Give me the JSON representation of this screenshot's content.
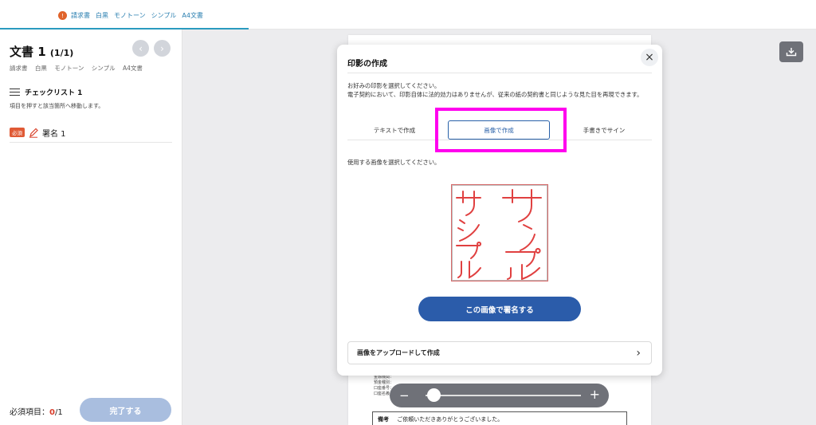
{
  "topbar": {
    "tab_badge": "!",
    "tags": [
      "請求書",
      "白黒",
      "モノトーン",
      "シンプル",
      "A4文書"
    ]
  },
  "sidebar": {
    "doc_title": "文書 1",
    "doc_count": "(1/1)",
    "prev_icon": "chevron-left-icon",
    "next_icon": "chevron-right-icon",
    "tags": [
      "請求書",
      "白黒",
      "モノトーン",
      "シンプル",
      "A4文書"
    ],
    "checklist_title": "チェックリスト 1",
    "checklist_desc": "項目を押すと該当箇所へ移動します。",
    "sig_required_tag": "必須",
    "sig_label": "署名 1",
    "required_label": "必須項目：",
    "required_done": "0",
    "required_total": "/1",
    "complete_button": "完了する"
  },
  "document": {
    "meta_lines": [
      "金融機関：",
      "預金種別：",
      "口座番号：",
      "口座名義："
    ],
    "remark_key": "備考",
    "remark_text": "ご依頼いただきありがとうございました。"
  },
  "zoom": {
    "minus": "−",
    "plus": "+",
    "level": 0.05
  },
  "modal": {
    "title": "印影の作成",
    "close": "×",
    "desc_line1": "お好みの印影を選択してください。",
    "desc_line2": "電子契約において、印影自体に法的効力はありませんが、従来の紙の契約書と同じような見た目を再現できます。",
    "tabs": {
      "text": "テキストで作成",
      "image": "画像で作成",
      "hand": "手書きでサイン"
    },
    "select_label": "使用する画像を選択してください。",
    "stamp_text": "サンプル",
    "sign_button": "この画像で署名する",
    "upload_row": "画像をアップロードして作成",
    "upload_chevron": "›"
  },
  "colors": {
    "accent": "#2b5caa",
    "highlight": "#ff00ee",
    "required": "#d93c2a",
    "stamp": "#e04040"
  }
}
